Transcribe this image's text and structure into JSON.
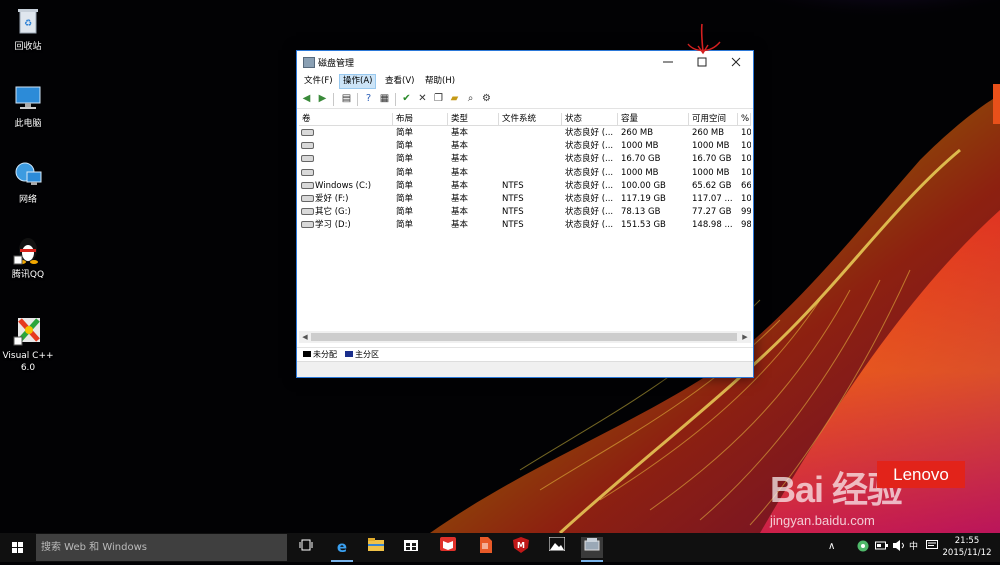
{
  "desktop": {
    "icons": [
      {
        "label": "回收站"
      },
      {
        "label": "此电脑"
      },
      {
        "label": "网络"
      },
      {
        "label": "腾讯QQ"
      },
      {
        "label": "Visual C++ 6.0"
      }
    ]
  },
  "watermark": {
    "baidu": "Bai  经验",
    "url": "jingyan.baidu.com",
    "lenovo": "Lenovo"
  },
  "window": {
    "title": "磁盘管理",
    "menu": [
      "文件(F)",
      "操作(A)",
      "查看(V)",
      "帮助(H)"
    ],
    "active_menu_index": 1,
    "columns": [
      "卷",
      "布局",
      "类型",
      "文件系统",
      "状态",
      "容量",
      "可用空间",
      "%"
    ],
    "rows": [
      {
        "volume": "",
        "layout": "简单",
        "type": "基本",
        "fs": "",
        "status": "状态良好 (...",
        "capacity": "260 MB",
        "free": "260 MB",
        "pct": "10"
      },
      {
        "volume": "",
        "layout": "简单",
        "type": "基本",
        "fs": "",
        "status": "状态良好 (...",
        "capacity": "1000 MB",
        "free": "1000 MB",
        "pct": "10"
      },
      {
        "volume": "",
        "layout": "简单",
        "type": "基本",
        "fs": "",
        "status": "状态良好 (...",
        "capacity": "16.70 GB",
        "free": "16.70 GB",
        "pct": "10"
      },
      {
        "volume": "",
        "layout": "简单",
        "type": "基本",
        "fs": "",
        "status": "状态良好 (...",
        "capacity": "1000 MB",
        "free": "1000 MB",
        "pct": "10"
      },
      {
        "volume": "Windows (C:)",
        "layout": "简单",
        "type": "基本",
        "fs": "NTFS",
        "status": "状态良好 (...",
        "capacity": "100.00 GB",
        "free": "65.62 GB",
        "pct": "66"
      },
      {
        "volume": "爱好 (F:)",
        "layout": "简单",
        "type": "基本",
        "fs": "NTFS",
        "status": "状态良好 (...",
        "capacity": "117.19 GB",
        "free": "117.07 ...",
        "pct": "10"
      },
      {
        "volume": "其它 (G:)",
        "layout": "简单",
        "type": "基本",
        "fs": "NTFS",
        "status": "状态良好 (...",
        "capacity": "78.13 GB",
        "free": "77.27 GB",
        "pct": "99"
      },
      {
        "volume": "学习 (D:)",
        "layout": "简单",
        "type": "基本",
        "fs": "NTFS",
        "status": "状态良好 (...",
        "capacity": "151.53 GB",
        "free": "148.98 ...",
        "pct": "98"
      }
    ],
    "legend": [
      {
        "label": "未分配",
        "color": "#000000"
      },
      {
        "label": "主分区",
        "color": "#1a2e8c"
      }
    ]
  },
  "taskbar": {
    "search_placeholder": "搜索 Web 和 Windows",
    "clock_time": "21:55",
    "clock_date": "2015/11/12"
  },
  "colors": {
    "window_border": "#2b78d8",
    "taskbar": "#101010",
    "accent": "#7ab4ea",
    "annotation": "#d42020"
  }
}
